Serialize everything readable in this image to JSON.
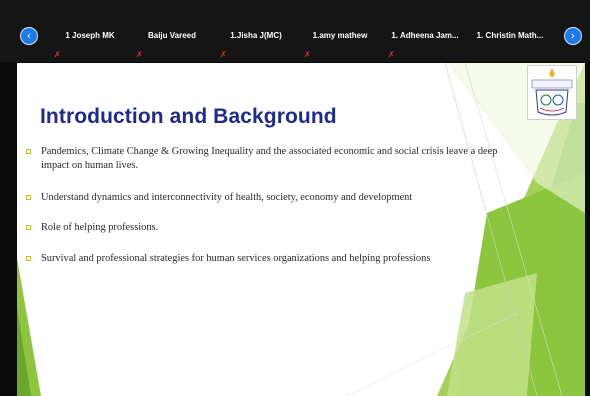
{
  "meeting": {
    "nav_prev_icon": "chevron-left-icon",
    "nav_next_icon": "chevron-right-icon",
    "participants": [
      {
        "name": "1 Joseph MK",
        "muted": true
      },
      {
        "name": "Baiju Vareed",
        "muted": true
      },
      {
        "name": "1.Jisha J(MC)",
        "muted": true
      },
      {
        "name": "1.amy mathew",
        "muted": true
      },
      {
        "name": "1. Adheena Jam...",
        "muted": true
      },
      {
        "name": "1. Christin Math...",
        "muted": false
      }
    ],
    "muted_icon": "mic-off-icon"
  },
  "slide": {
    "title": "Introduction and Background",
    "bullets": [
      "Pandemics, Climate Change & Growing Inequality and the associated economic and social crisis  leave a deep impact on human lives.",
      "Understand dynamics and interconnectivity of health, society, economy and development",
      "Role of helping professions.",
      "Survival and professional strategies for human services organizations and helping professions"
    ],
    "bullet_icon": "square-bullet-icon",
    "logo_icon": "university-emblem-icon"
  },
  "colors": {
    "strip_bg": "#151515",
    "nav_blue": "#1e7be6",
    "title_blue": "#1e2a8c",
    "accent_green": "#8cc63f",
    "muted_red": "#e0352f"
  }
}
